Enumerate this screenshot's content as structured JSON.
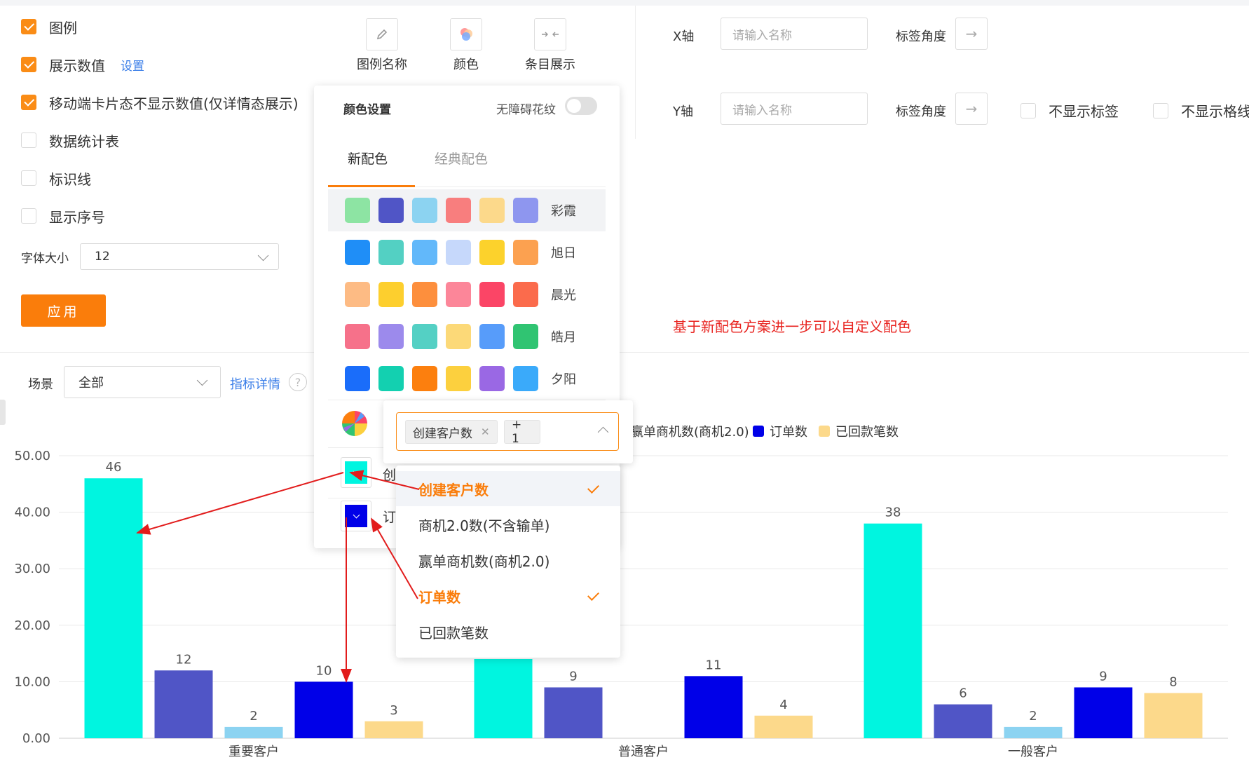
{
  "options": [
    {
      "label": "图例",
      "checked": true
    },
    {
      "label": "展示数值",
      "checked": true,
      "link": "设置"
    },
    {
      "label": "移动端卡片态不显示数值(仅详情态展示)",
      "checked": true
    },
    {
      "label": "数据统计表",
      "checked": false
    },
    {
      "label": "标识线",
      "checked": false
    },
    {
      "label": "显示序号",
      "checked": false
    }
  ],
  "font_size": {
    "label": "字体大小",
    "value": "12"
  },
  "apply_label": "应用",
  "tools": {
    "legend_name": "图例名称",
    "color": "颜色",
    "item_display": "条目展示"
  },
  "axes": {
    "x_label": "X轴",
    "y_label": "Y轴",
    "placeholder": "请输入名称",
    "tick_angle": "标签角度",
    "hide_labels": "不显示标签",
    "hide_grid": "不显示格线"
  },
  "annotation": "基于新配色方案进一步可以自定义配色",
  "scene": {
    "label": "场景",
    "value": "全部",
    "detail_link": "指标详情",
    "help": "?"
  },
  "color_popover": {
    "title": "颜色设置",
    "accessible_label": "无障碍花纹",
    "tabs": [
      "新配色",
      "经典配色"
    ],
    "palettes": [
      {
        "name": "彩霞",
        "colors": [
          "#8de4a3",
          "#5055c6",
          "#8cd3f1",
          "#f87e7e",
          "#fcd98b",
          "#8e96ef"
        ]
      },
      {
        "name": "旭日",
        "colors": [
          "#1f8ef7",
          "#53d0c3",
          "#62b8fa",
          "#c6d8fb",
          "#fcd22c",
          "#fca150"
        ]
      },
      {
        "name": "晨光",
        "colors": [
          "#fdbb84",
          "#fdcf2e",
          "#fd8f3d",
          "#fc8699",
          "#fb4566",
          "#fb6b4c"
        ]
      },
      {
        "name": "皓月",
        "colors": [
          "#f6718a",
          "#9c8aec",
          "#54d0c4",
          "#fcd978",
          "#579cfa",
          "#30c472"
        ]
      },
      {
        "name": "夕阳",
        "colors": [
          "#1a6dfa",
          "#13d0b0",
          "#fc7f0e",
          "#fcd03e",
          "#9a68e4",
          "#3aaafa"
        ]
      }
    ],
    "custom_rows": [
      {
        "color": "#00f5e0",
        "label": "创"
      },
      {
        "color": "#0000e8",
        "label": "订"
      }
    ]
  },
  "multiselect": {
    "tag": "创建客户数",
    "more": "+ 1",
    "items": [
      {
        "label": "创建客户数",
        "selected": true
      },
      {
        "label": "商机2.0数(不含输单)",
        "selected": false
      },
      {
        "label": "赢单商机数(商机2.0)",
        "selected": false
      },
      {
        "label": "订单数",
        "selected": true
      },
      {
        "label": "已回款笔数",
        "selected": false
      }
    ]
  },
  "legend": [
    {
      "name": "赢单商机数(商机2.0)",
      "color": ""
    },
    {
      "name": "订单数",
      "color": "#0000e8"
    },
    {
      "name": "已回款笔数",
      "color": "#fcd98b"
    }
  ],
  "chart_data": {
    "type": "bar",
    "categories": [
      "重要客户",
      "普通客户",
      "一般客户"
    ],
    "series": [
      {
        "name": "创建客户数",
        "color": "#00f5e0",
        "values": [
          46,
          null,
          38
        ]
      },
      {
        "name": "商机2.0数(不含输单)",
        "color": "#5055c6",
        "values": [
          12,
          9,
          6
        ]
      },
      {
        "name": "赢单商机数(商机2.0)",
        "color": "#8cd3f1",
        "values": [
          2,
          null,
          2
        ]
      },
      {
        "name": "订单数",
        "color": "#0000e8",
        "values": [
          10,
          11,
          9
        ]
      },
      {
        "name": "已回款笔数",
        "color": "#fcd98b",
        "values": [
          3,
          4,
          8
        ]
      }
    ],
    "y_ticks": [
      "0.00",
      "10.00",
      "20.00",
      "30.00",
      "40.00",
      "50.00"
    ],
    "ylim": [
      0,
      50
    ],
    "grid": true
  }
}
